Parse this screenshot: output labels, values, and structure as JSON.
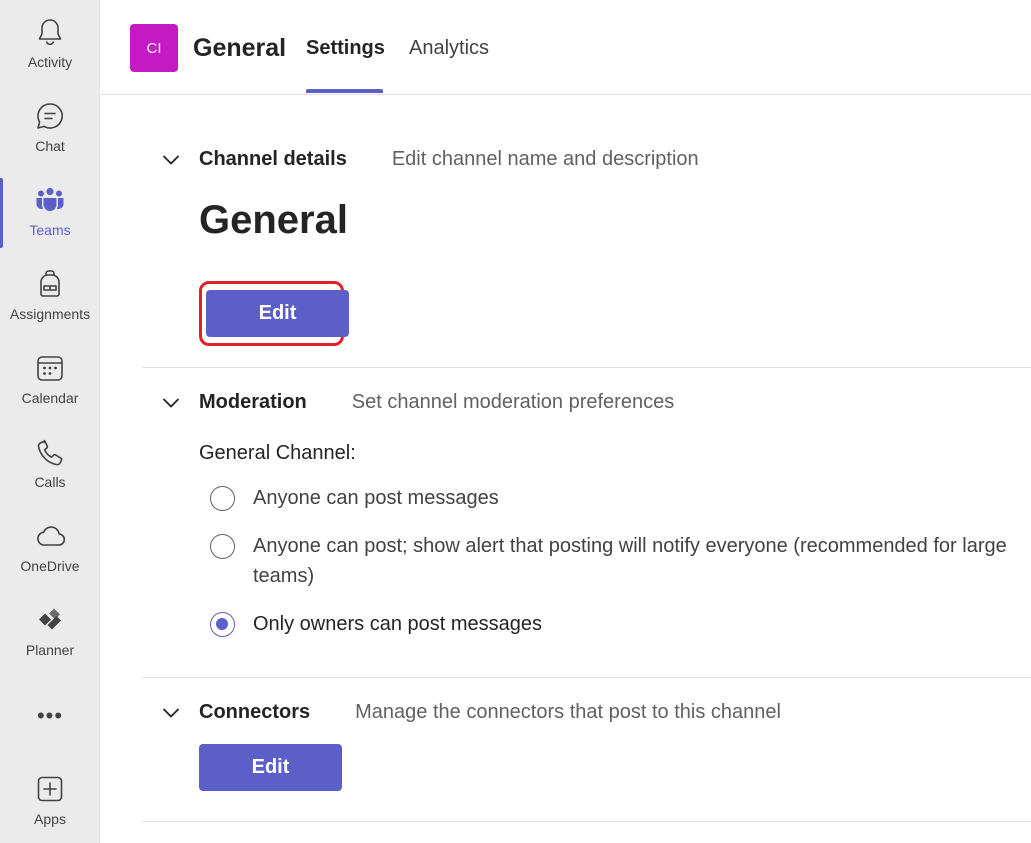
{
  "rail": {
    "items": [
      {
        "label": "Activity",
        "icon": "bell-icon"
      },
      {
        "label": "Chat",
        "icon": "chat-icon"
      },
      {
        "label": "Teams",
        "icon": "teams-icon",
        "active": true
      },
      {
        "label": "Assignments",
        "icon": "backpack-icon"
      },
      {
        "label": "Calendar",
        "icon": "calendar-icon"
      },
      {
        "label": "Calls",
        "icon": "phone-icon"
      },
      {
        "label": "OneDrive",
        "icon": "cloud-icon"
      },
      {
        "label": "Planner",
        "icon": "planner-icon"
      },
      {
        "label": "Apps",
        "icon": "add-app-icon"
      }
    ],
    "more": "•••"
  },
  "header": {
    "avatar_initials": "CI",
    "avatar_color": "#c619c6",
    "title": "General",
    "tabs": [
      {
        "label": "Settings",
        "active": true
      },
      {
        "label": "Analytics",
        "active": false
      }
    ]
  },
  "sections": {
    "channel_details": {
      "title": "Channel details",
      "description": "Edit channel name and description",
      "channel_name": "General",
      "edit_label": "Edit"
    },
    "moderation": {
      "title": "Moderation",
      "description": "Set channel moderation preferences",
      "sub_label": "General Channel:",
      "options": [
        {
          "label": "Anyone can post messages",
          "checked": false
        },
        {
          "label": "Anyone can post; show alert that posting will notify everyone (recommended for large teams)",
          "checked": false
        },
        {
          "label": "Only owners can post messages",
          "checked": true
        }
      ]
    },
    "connectors": {
      "title": "Connectors",
      "description": "Manage the connectors that post to this channel",
      "edit_label": "Edit"
    }
  },
  "colors": {
    "accent": "#5b5fc7",
    "highlight": "#e0202a"
  }
}
